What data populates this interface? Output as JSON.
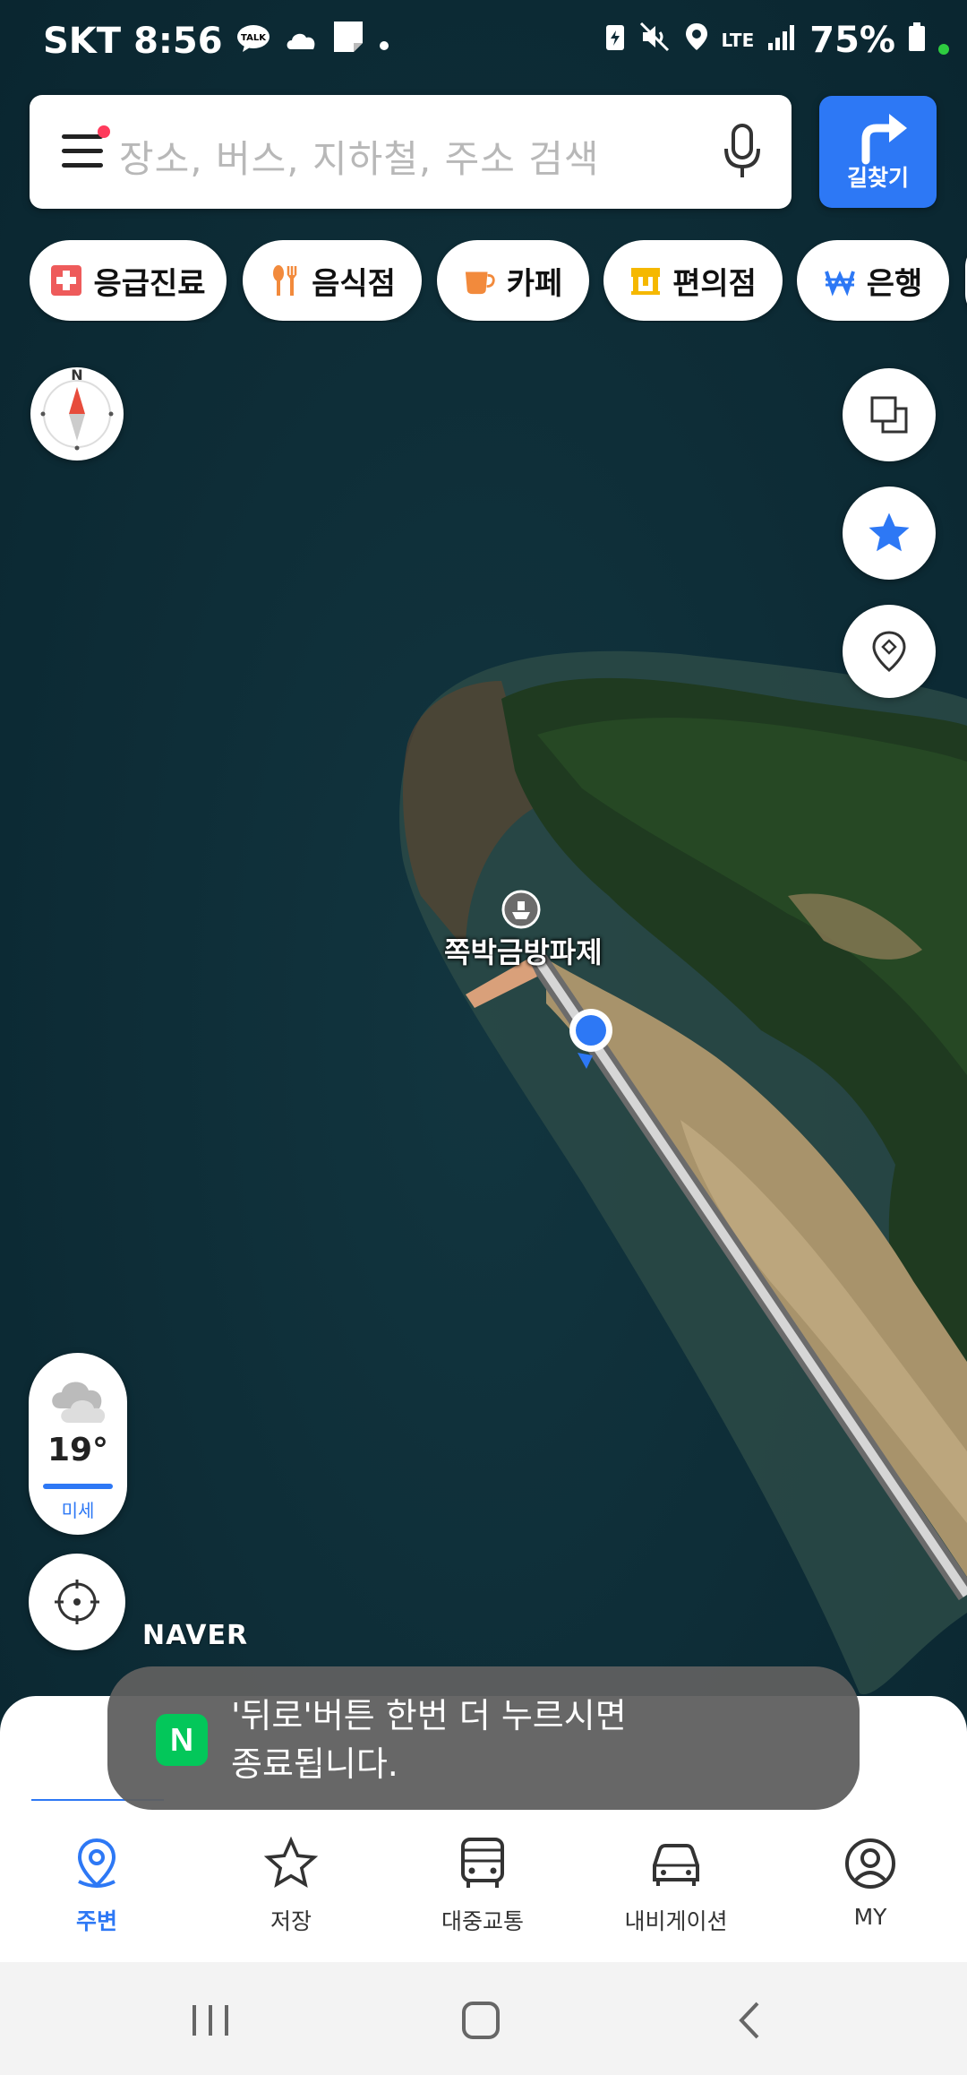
{
  "status_bar": {
    "carrier": "SKT",
    "time": "8:56",
    "network": "LTE",
    "battery": "75%"
  },
  "search": {
    "placeholder": "장소, 버스, 지하철, 주소 검색",
    "route_label": "길찾기"
  },
  "categories": [
    {
      "label": "응급진료",
      "icon": "medical-cross-icon",
      "color": "#ee5b5b"
    },
    {
      "label": "음식점",
      "icon": "utensils-icon",
      "color": "#f28a3c"
    },
    {
      "label": "카페",
      "icon": "coffee-cup-icon",
      "color": "#f28a3c"
    },
    {
      "label": "편의점",
      "icon": "store-icon",
      "color": "#f5b800"
    },
    {
      "label": "은행",
      "icon": "won-icon",
      "color": "#2d78f5"
    }
  ],
  "map": {
    "place_label": "쪽박금방파제",
    "naver_logo": "NAVER"
  },
  "weather": {
    "temperature": "19°",
    "dust_label": "미세"
  },
  "toast": {
    "message": "'뒤로'버튼 한번 더 누르시면\n종료됩니다.",
    "app_icon_letter": "N"
  },
  "tabs": [
    {
      "label": "주변",
      "icon": "location-pin-icon",
      "active": true
    },
    {
      "label": "저장",
      "icon": "star-icon",
      "active": false
    },
    {
      "label": "대중교통",
      "icon": "bus-icon",
      "active": false
    },
    {
      "label": "내비게이션",
      "icon": "car-icon",
      "active": false
    },
    {
      "label": "MY",
      "icon": "profile-icon",
      "active": false
    }
  ],
  "colors": {
    "accent": "#2d78f5",
    "naver_green": "#03c75a"
  }
}
